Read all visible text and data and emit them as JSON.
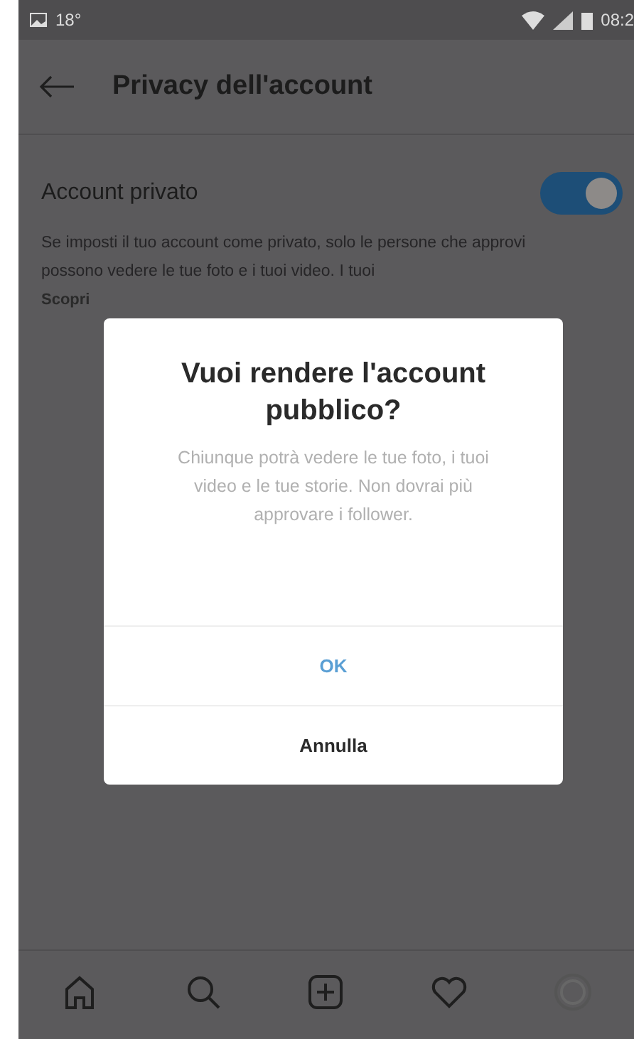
{
  "status_bar": {
    "temperature": "18°",
    "time": "08:2"
  },
  "header": {
    "title": "Privacy dell'account"
  },
  "setting": {
    "label": "Account privato",
    "on": true,
    "description": "Se imposti il tuo account come privato, solo le persone che approvi possono vedere le tue foto e i tuoi video. I tuoi",
    "link": "Scopri"
  },
  "dialog": {
    "title": "Vuoi rendere l'account pubblico?",
    "message": "Chiunque potrà vedere le tue foto, i tuoi video e le tue storie. Non dovrai più approvare i follower.",
    "buttons": [
      {
        "label": "OK",
        "kind": "primary"
      },
      {
        "label": "Annulla",
        "kind": "secondary"
      }
    ]
  },
  "nav": [
    {
      "kind": "home"
    },
    {
      "kind": "search"
    },
    {
      "kind": "add"
    },
    {
      "kind": "heart"
    },
    {
      "kind": "profile"
    }
  ]
}
